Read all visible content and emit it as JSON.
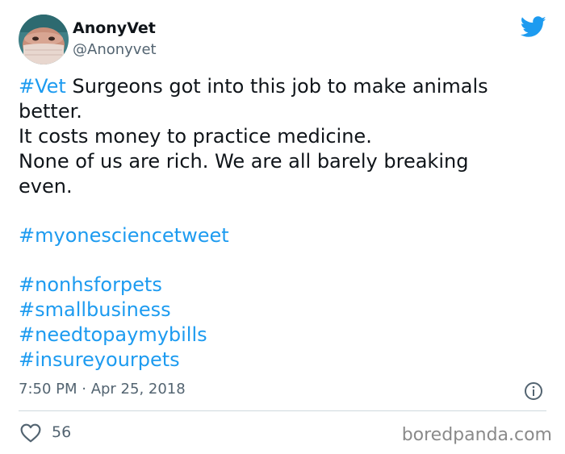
{
  "author": {
    "display_name": "AnonyVet",
    "handle": "@Anonyvet",
    "avatar_icon": "avatar-photo-masked-vet"
  },
  "brand": {
    "icon": "twitter-bird-icon",
    "color": "#1d9bf0"
  },
  "tweet": {
    "hashtag_vet": "#Vet",
    "line1_rest": " Surgeons got into this job to make animals",
    "line2": "better.",
    "line3": "It costs money to practice medicine.",
    "line4": "None of us are rich. We are all barely breaking",
    "line5": "even.",
    "hashtags": [
      "#myonesciencetweet",
      "#nonhsforpets",
      "#smallbusiness",
      "#needtopaymybills",
      "#insureyourpets"
    ]
  },
  "meta": {
    "timestamp": "7:50 PM · Apr 25, 2018"
  },
  "actions": {
    "like_count": "56"
  },
  "watermark": "boredpanda.com",
  "colors": {
    "link": "#1d9bf0",
    "muted": "#536471",
    "text": "#0f1419"
  }
}
